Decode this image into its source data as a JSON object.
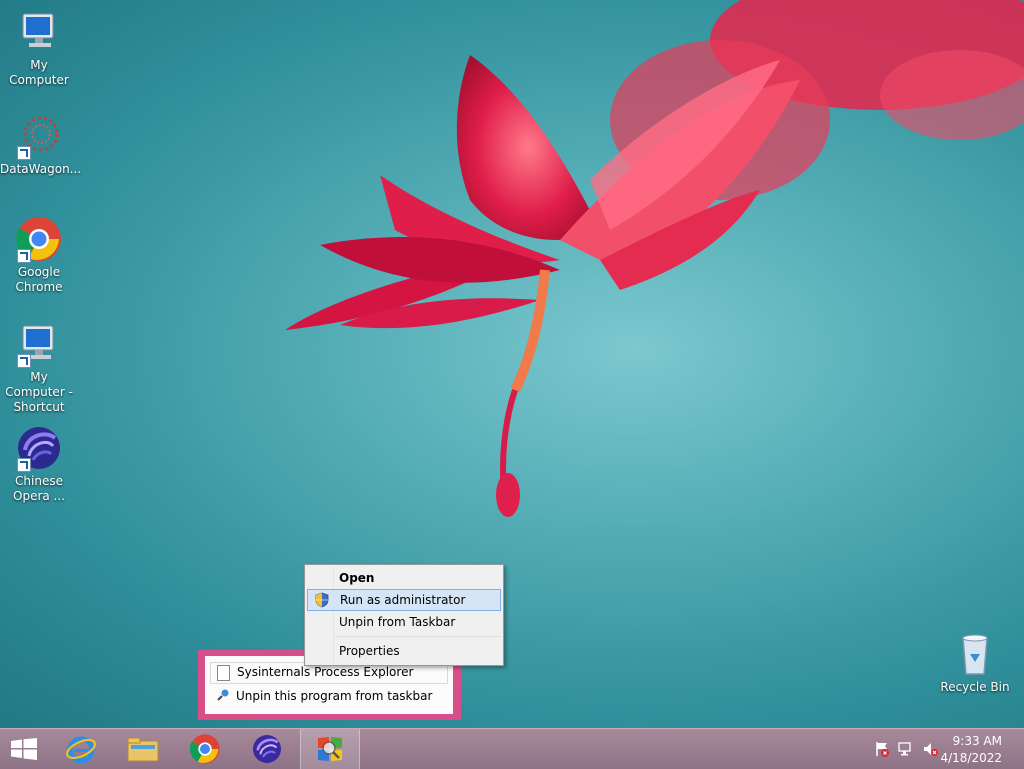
{
  "desktop": {
    "icons": [
      {
        "label": "My Computer"
      },
      {
        "label": "DataWagon..."
      },
      {
        "label": "Google Chrome"
      },
      {
        "label": "My Computer - Shortcut"
      },
      {
        "label": "Chinese Opera ..."
      },
      {
        "label": "Recycle Bin"
      }
    ]
  },
  "context_menu": {
    "items": [
      {
        "label": "Open",
        "bold": true
      },
      {
        "label": "Run as administrator",
        "icon": "uac-shield-icon",
        "highlighted": true
      },
      {
        "label": "Unpin from Taskbar"
      },
      {
        "label": "Properties"
      }
    ]
  },
  "jump_list": {
    "items": [
      {
        "label": "Sysinternals Process Explorer",
        "icon": "document-icon"
      },
      {
        "label": "Unpin this program from taskbar",
        "icon": "pin-icon"
      }
    ]
  },
  "taskbar": {
    "buttons": [
      "start-button",
      "internet-explorer",
      "file-explorer",
      "google-chrome",
      "chinese-opera",
      "process-explorer"
    ],
    "tray": [
      "action-center-flag-icon",
      "network-icon",
      "volume-muted-icon"
    ],
    "clock": {
      "time": "9:33 AM",
      "date": "4/18/2022"
    }
  },
  "colors": {
    "jump_list_accent": "#e04c89",
    "menu_highlight": "#d5e5f6",
    "taskbar": "#9b7f91"
  }
}
